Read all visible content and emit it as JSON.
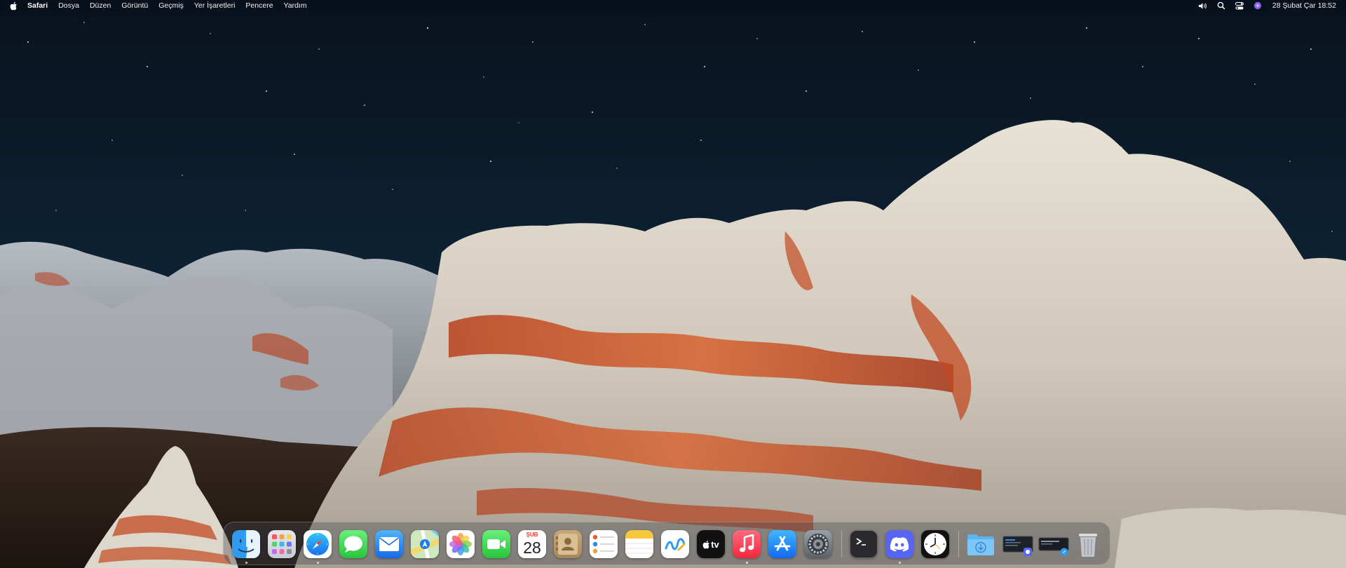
{
  "menubar": {
    "apple_icon": "apple-logo-icon",
    "items": [
      {
        "label": "Safari",
        "bold": true
      },
      {
        "label": "Dosya"
      },
      {
        "label": "Düzen"
      },
      {
        "label": "Görüntü"
      },
      {
        "label": "Geçmiş"
      },
      {
        "label": "Yer İşaretleri"
      },
      {
        "label": "Pencere"
      },
      {
        "label": "Yardım"
      }
    ],
    "status_icons": [
      "volume-icon",
      "spotlight-search-icon",
      "control-center-icon",
      "siri-icon"
    ],
    "clock": "28 Şubat Çar  18:52"
  },
  "dock": {
    "apps": [
      {
        "name": "Finder",
        "icon": "finder-icon",
        "running": true
      },
      {
        "name": "Launchpad",
        "icon": "launchpad-icon",
        "running": false
      },
      {
        "name": "Safari",
        "icon": "safari-icon",
        "running": true
      },
      {
        "name": "Messages",
        "icon": "messages-icon",
        "running": false
      },
      {
        "name": "Mail",
        "icon": "mail-icon",
        "running": false
      },
      {
        "name": "Maps",
        "icon": "maps-icon",
        "running": false
      },
      {
        "name": "Photos",
        "icon": "photos-icon",
        "running": false
      },
      {
        "name": "FaceTime",
        "icon": "facetime-icon",
        "running": false
      },
      {
        "name": "Calendar",
        "icon": "calendar-icon",
        "running": false,
        "month": "ŞUB",
        "day": "28"
      },
      {
        "name": "Contacts",
        "icon": "contacts-icon",
        "running": false
      },
      {
        "name": "Reminders",
        "icon": "reminders-icon",
        "running": false
      },
      {
        "name": "Notes",
        "icon": "notes-icon",
        "running": false
      },
      {
        "name": "Freeform",
        "icon": "freeform-icon",
        "running": false
      },
      {
        "name": "TV",
        "icon": "apple-tv-icon",
        "running": false,
        "label": "tv"
      },
      {
        "name": "Music",
        "icon": "music-icon",
        "running": true
      },
      {
        "name": "App Store",
        "icon": "app-store-icon",
        "running": false
      },
      {
        "name": "System Settings",
        "icon": "system-settings-icon",
        "running": false
      }
    ],
    "recent_apps": [
      {
        "name": "Terminal",
        "icon": "terminal-icon",
        "running": false
      },
      {
        "name": "Discord",
        "icon": "discord-icon",
        "running": true
      },
      {
        "name": "Clock",
        "icon": "clock-icon",
        "running": false
      }
    ],
    "stacks": [
      {
        "name": "Downloads",
        "icon": "downloads-folder-icon"
      },
      {
        "name": "Minimized window 1",
        "icon": "minimized-window-thumbnail"
      },
      {
        "name": "Minimized window 2",
        "icon": "minimized-window-thumbnail"
      },
      {
        "name": "Trash",
        "icon": "trash-icon"
      }
    ]
  },
  "colors": {
    "sky": "#0b1a2a",
    "rock": "#d9d3c8",
    "rock_red": "#c24a22"
  }
}
